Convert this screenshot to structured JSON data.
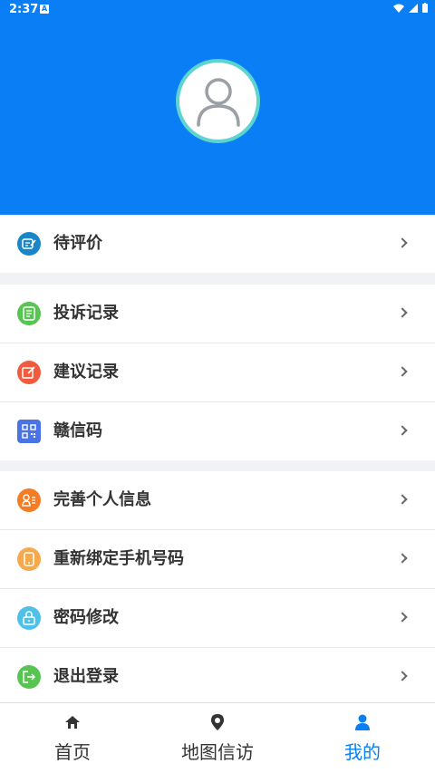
{
  "statusbar": {
    "time": "2:37",
    "indicator": "A"
  },
  "colors": {
    "header": "#0a7ff5",
    "active_tab": "#0a7ff5"
  },
  "menu": {
    "group1": [
      {
        "label": "待评价",
        "icon": "evaluate-icon",
        "color": "#1a86c8"
      }
    ],
    "group2": [
      {
        "label": "投诉记录",
        "icon": "complaint-record-icon",
        "color": "#58c552"
      },
      {
        "label": "建议记录",
        "icon": "suggestion-record-icon",
        "color": "#f05b3f"
      },
      {
        "label": "赣信码",
        "icon": "qr-code-icon",
        "color": "#4a74e6"
      }
    ],
    "group3": [
      {
        "label": "完善个人信息",
        "icon": "personal-info-icon",
        "color": "#f57c25"
      },
      {
        "label": "重新绑定手机号码",
        "icon": "phone-icon",
        "color": "#f6a94a"
      },
      {
        "label": "密码修改",
        "icon": "lock-icon",
        "color": "#4fc0e8"
      },
      {
        "label": "退出登录",
        "icon": "logout-icon",
        "color": "#58c552"
      }
    ]
  },
  "tabs": [
    {
      "label": "首页",
      "icon": "home-icon",
      "active": false
    },
    {
      "label": "地图信访",
      "icon": "map-pin-icon",
      "active": false
    },
    {
      "label": "我的",
      "icon": "user-icon",
      "active": true
    }
  ]
}
